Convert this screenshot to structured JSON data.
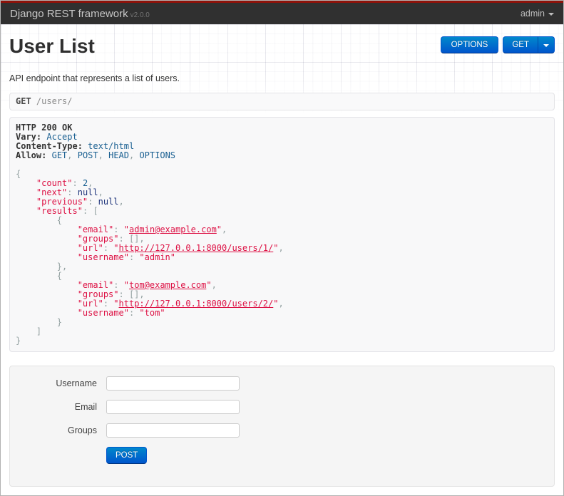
{
  "navbar": {
    "brand": "Django REST framework",
    "version": "v2.0.0",
    "user_menu": "admin"
  },
  "header": {
    "title": "User List",
    "description": "API endpoint that represents a list of users.",
    "options_button": "OPTIONS",
    "get_button": "GET"
  },
  "request": {
    "method": "GET",
    "path": "/users/"
  },
  "response": {
    "status_line": "HTTP 200 OK",
    "headers": [
      {
        "name": "Vary:",
        "value": "Accept"
      },
      {
        "name": "Content-Type:",
        "value": "text/html"
      },
      {
        "name": "Allow:",
        "value": "GET, POST, HEAD, OPTIONS"
      }
    ],
    "body": {
      "count": 2,
      "next": null,
      "previous": null,
      "results": [
        {
          "email": "admin@example.com",
          "groups": [],
          "url": "http://127.0.0.1:8000/users/1/",
          "username": "admin"
        },
        {
          "email": "tom@example.com",
          "groups": [],
          "url": "http://127.0.0.1:8000/users/2/",
          "username": "tom"
        }
      ]
    }
  },
  "form": {
    "fields": [
      {
        "label": "Username"
      },
      {
        "label": "Email"
      },
      {
        "label": "Groups"
      }
    ],
    "submit_label": "POST"
  },
  "colors": {
    "navbar_bg": "#303030",
    "navbar_stripe": "#8d130b",
    "button_blue_top": "#0088cc",
    "button_blue_bottom": "#0055cc",
    "token_string": "#dd1144",
    "token_literal": "#195f91",
    "token_keyword": "#1e347b",
    "token_punctuation": "#93a1a1",
    "header_value_blue": "#195f91"
  }
}
